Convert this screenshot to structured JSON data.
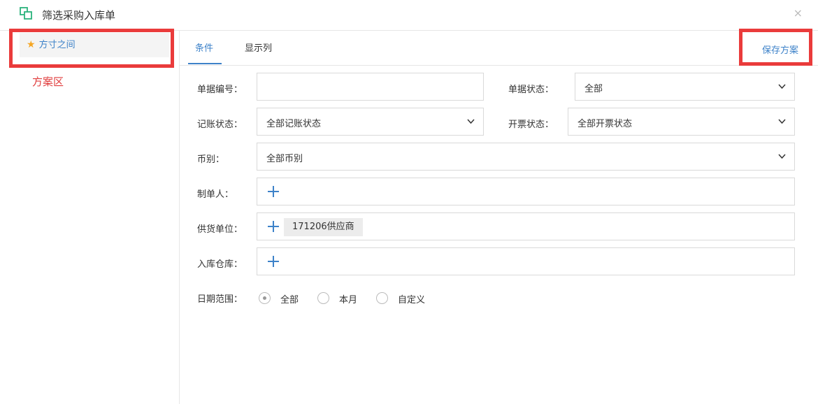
{
  "window": {
    "title": "筛选采购入库单",
    "close_glyph": "×"
  },
  "sidebar": {
    "scheme_name": "方寸之间",
    "star_glyph": "★",
    "area_label": "方案区"
  },
  "tabs": [
    {
      "label": "条件",
      "active": true
    },
    {
      "label": "显示列",
      "active": false
    }
  ],
  "save_scheme_label": "保存方案",
  "form": {
    "doc_no": {
      "label": "单据编号：",
      "value": ""
    },
    "doc_status": {
      "label": "单据状态：",
      "value": "全部"
    },
    "bookkeeping_status": {
      "label": "记账状态：",
      "value": "全部记账状态"
    },
    "invoice_status": {
      "label": "开票状态：",
      "value": "全部开票状态"
    },
    "currency": {
      "label": "币别：",
      "value": "全部币别"
    },
    "creator": {
      "label": "制单人："
    },
    "supplier": {
      "label": "供货单位：",
      "tags": [
        "171206供应商"
      ]
    },
    "warehouse": {
      "label": "入库仓库："
    },
    "date_range": {
      "label": "日期范围：",
      "options": [
        "全部",
        "本月",
        "自定义"
      ],
      "selected": "全部"
    }
  },
  "colors": {
    "accent": "#3d82c9",
    "highlight_red": "#ea3b3b",
    "star": "#f5a623"
  }
}
